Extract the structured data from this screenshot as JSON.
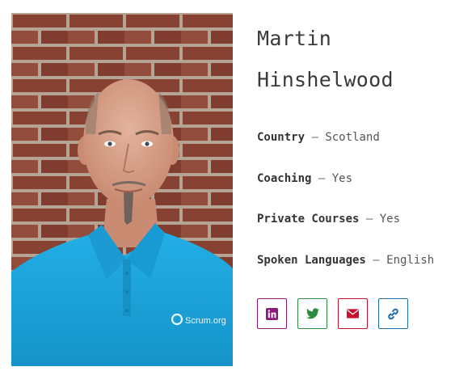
{
  "profile": {
    "first_name": "Martin",
    "last_name": "Hinshelwood",
    "photo_alt": "Martin Hinshelwood",
    "shirt_logo_text": "Scrum.org"
  },
  "fields": [
    {
      "label": "Country",
      "separator": "—",
      "value": "Scotland"
    },
    {
      "label": "Coaching",
      "separator": "—",
      "value": "Yes"
    },
    {
      "label": "Private Courses",
      "separator": "—",
      "value": "Yes"
    },
    {
      "label": "Spoken Languages",
      "separator": "—",
      "value": "English"
    }
  ],
  "social": [
    {
      "icon": "linkedin-icon",
      "color": "#8b1a7b"
    },
    {
      "icon": "twitter-icon",
      "color": "#2e8b3e"
    },
    {
      "icon": "email-icon",
      "color": "#c8102e"
    },
    {
      "icon": "link-icon",
      "color": "#1f6fb2"
    }
  ],
  "colors": {
    "brick": "#8d4a38",
    "mortar": "#c9b9a8",
    "shirt": "#1aa3dc",
    "skin": "#d9a28a"
  }
}
